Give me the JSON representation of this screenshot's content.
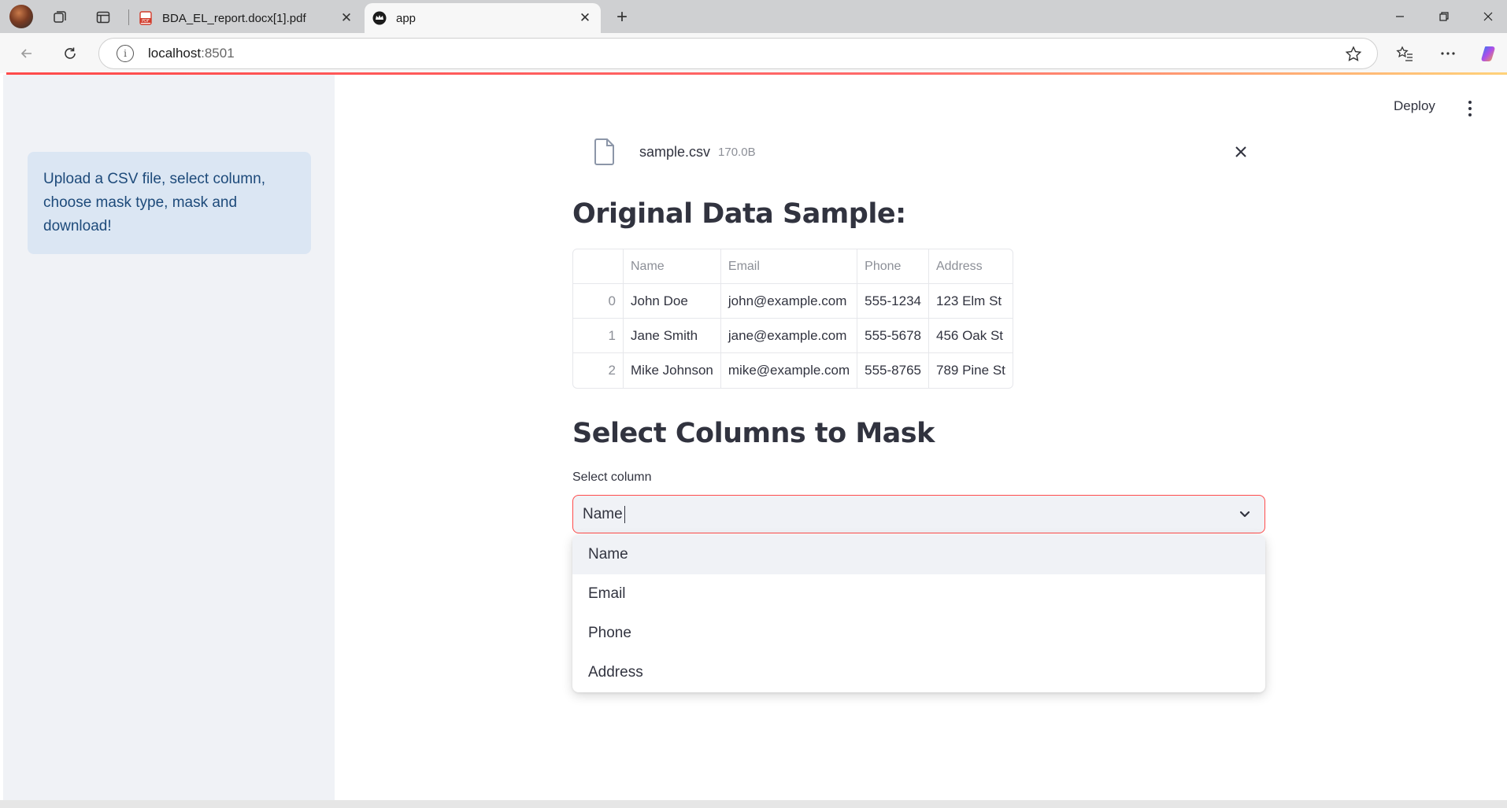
{
  "browser": {
    "tabs": [
      {
        "title": "BDA_EL_report.docx[1].pdf",
        "favicon": "pdf-icon",
        "active": false
      },
      {
        "title": "app",
        "favicon": "streamlit-crown-icon",
        "active": true
      }
    ],
    "url_host": "localhost",
    "url_port": ":8501"
  },
  "sidebar": {
    "info_text": "Upload a CSV file, select column, choose mask type, mask and download!"
  },
  "header": {
    "deploy_label": "Deploy"
  },
  "uploaded_file": {
    "name": "sample.csv",
    "size": "170.0B"
  },
  "original_section": {
    "title": "Original Data Sample:"
  },
  "table": {
    "columns": [
      "Name",
      "Email",
      "Phone",
      "Address"
    ],
    "rows": [
      {
        "index": "0",
        "cells": [
          "John Doe",
          "john@example.com",
          "555-1234",
          "123 Elm St"
        ]
      },
      {
        "index": "1",
        "cells": [
          "Jane Smith",
          "jane@example.com",
          "555-5678",
          "456 Oak St"
        ]
      },
      {
        "index": "2",
        "cells": [
          "Mike Johnson",
          "mike@example.com",
          "555-8765",
          "789 Pine St"
        ]
      }
    ]
  },
  "mask_section": {
    "title": "Select Columns to Mask",
    "select_label": "Select column",
    "select_value": "Name",
    "options": [
      "Name",
      "Email",
      "Phone",
      "Address"
    ],
    "highlighted_option": "Name"
  },
  "colors": {
    "accent": "#ff4b4b",
    "sidebar_bg": "#f0f2f6",
    "info_bg": "#dbe6f3",
    "info_text": "#1d4a7a"
  }
}
